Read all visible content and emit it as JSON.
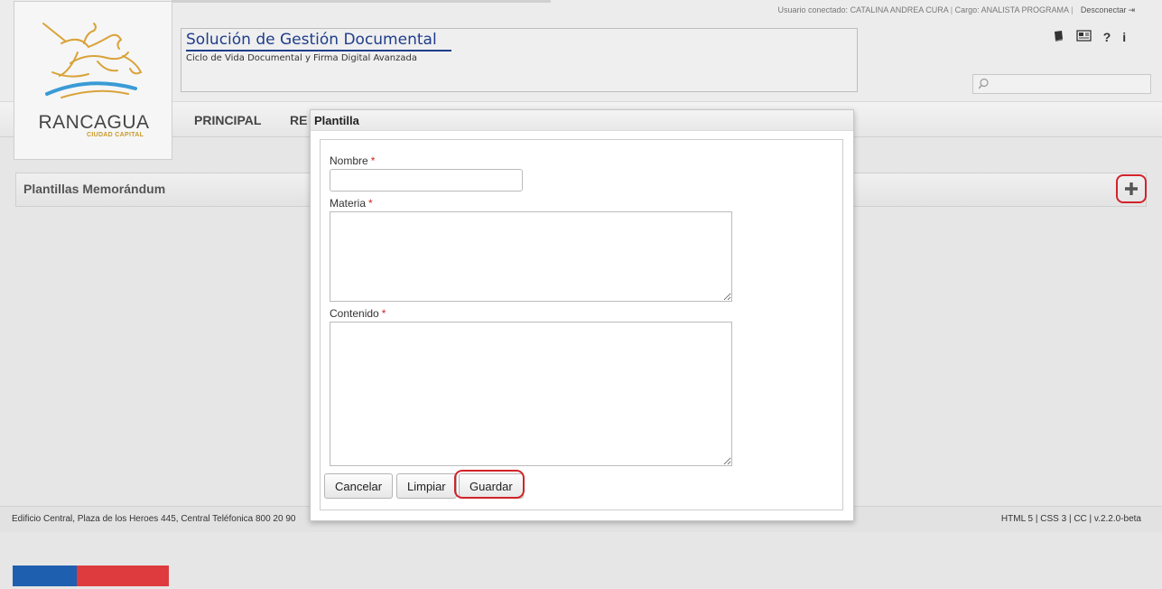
{
  "topbar": {
    "user_label": "Usuario conectado:",
    "user_name": "CATALINA ANDREA CURA",
    "role_label": "Cargo:",
    "role_name": "ANALISTA PROGRAMA",
    "logout_label": "Desconectar",
    "logout_icon": "exit-icon"
  },
  "logo": {
    "name": "RANCAGUA",
    "subtitle": "CIUDAD CAPITAL",
    "colors": {
      "gold": "#d9a33a",
      "blue": "#3a9bd5"
    }
  },
  "header": {
    "title": "Solución de Gestión Documental",
    "subtitle": "Ciclo de Vida Documental y Firma Digital Avanzada",
    "icons": [
      "book-icon",
      "newspaper-icon",
      "help-icon",
      "info-icon"
    ],
    "icon_glyphs": {
      "help": "?",
      "info": "i"
    },
    "search": {
      "placeholder": ""
    }
  },
  "nav": {
    "items": [
      {
        "label": "PRINCIPAL"
      },
      {
        "label": "RE"
      }
    ]
  },
  "panel": {
    "title": "Plantillas Memorándum",
    "add_icon": "plus-icon"
  },
  "modal": {
    "title": "Plantilla",
    "fields": {
      "nombre": {
        "label": "Nombre",
        "value": ""
      },
      "materia": {
        "label": "Materia",
        "value": ""
      },
      "contenido": {
        "label": "Contenido",
        "value": ""
      }
    },
    "required_marker": "*",
    "buttons": {
      "cancel": "Cancelar",
      "clear": "Limpiar",
      "save": "Guardar"
    }
  },
  "footer": {
    "address": "Edificio Central, Plaza de los Heroes 445, Central Teléfonica 800 20 90",
    "tech": "HTML 5 | CSS 3 | CC | v.2.2.0-beta"
  },
  "colors": {
    "accent_red": "#d2232a",
    "title_blue": "#1e3d8a",
    "flag_blue": "#1f5fb0",
    "flag_red": "#de3b3e"
  }
}
